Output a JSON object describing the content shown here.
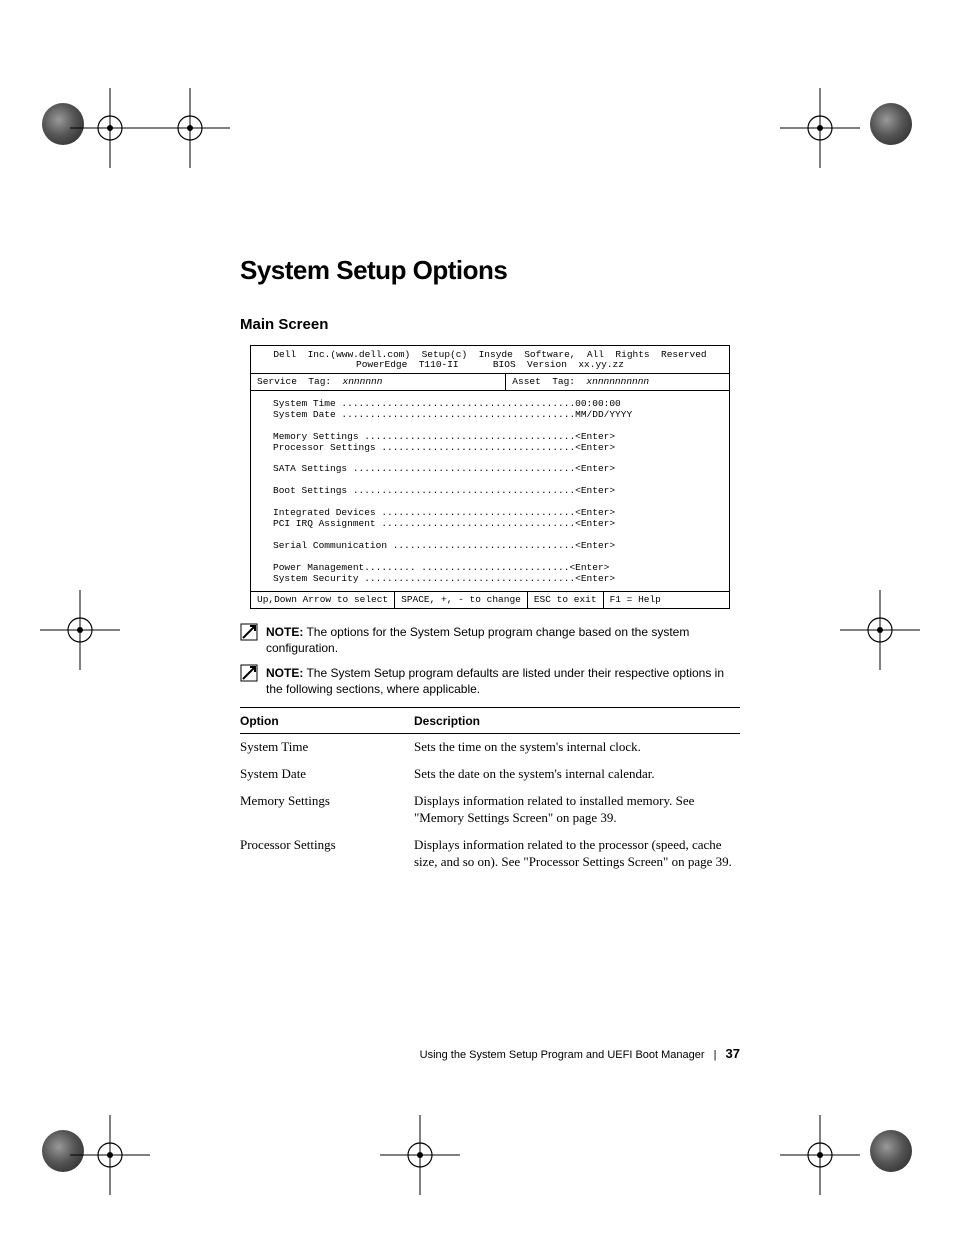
{
  "heading": "System Setup Options",
  "subheading": "Main Screen",
  "bios": {
    "header_l1": "Dell  Inc.(www.dell.com)  Setup(c)  Insyde  Software,  All  Rights  Reserved",
    "header_l2": "PowerEdge  T110-II      BIOS  Version  xx.yy.zz",
    "service_tag_label": "Service  Tag:  ",
    "service_tag_value": "xnnnnnn",
    "asset_tag_label": "Asset  Tag:  ",
    "asset_tag_value": "xnnnnnnnnnn",
    "body": "System Time .........................................00:00:00\nSystem Date .........................................MM/DD/YYYY\n\nMemory Settings .....................................<Enter>\nProcessor Settings ..................................<Enter>\n\nSATA Settings .......................................<Enter>\n\nBoot Settings .......................................<Enter>\n\nIntegrated Devices ..................................<Enter>\nPCI IRQ Assignment ..................................<Enter>\n\nSerial Communication ................................<Enter>\n\nPower Management......... ..........................<Enter>\nSystem Security .....................................<Enter>",
    "footer": {
      "a": "Up,Down Arrow to select",
      "b": "SPACE, +, - to change",
      "c": "ESC to exit",
      "d": "F1 = Help"
    }
  },
  "notes": {
    "label": "NOTE:",
    "n1": " The options for the System Setup program change based on the system configuration.",
    "n2": " The System Setup program defaults are listed under their respective options in the following sections, where applicable."
  },
  "table": {
    "col1": "Option",
    "col2": "Description",
    "rows": [
      {
        "opt": "System Time",
        "desc": "Sets the time on the system's internal clock."
      },
      {
        "opt": "System Date",
        "desc": "Sets the date on the system's internal calendar."
      },
      {
        "opt": "Memory Settings",
        "desc": "Displays information related to installed memory. See \"Memory Settings Screen\" on page 39."
      },
      {
        "opt": "Processor Settings",
        "desc": "Displays information related to the processor (speed, cache size, and so on). See \"Processor Settings Screen\" on page 39."
      }
    ]
  },
  "footer": {
    "text": "Using the System Setup Program and UEFI Boot Manager",
    "page": "37"
  }
}
